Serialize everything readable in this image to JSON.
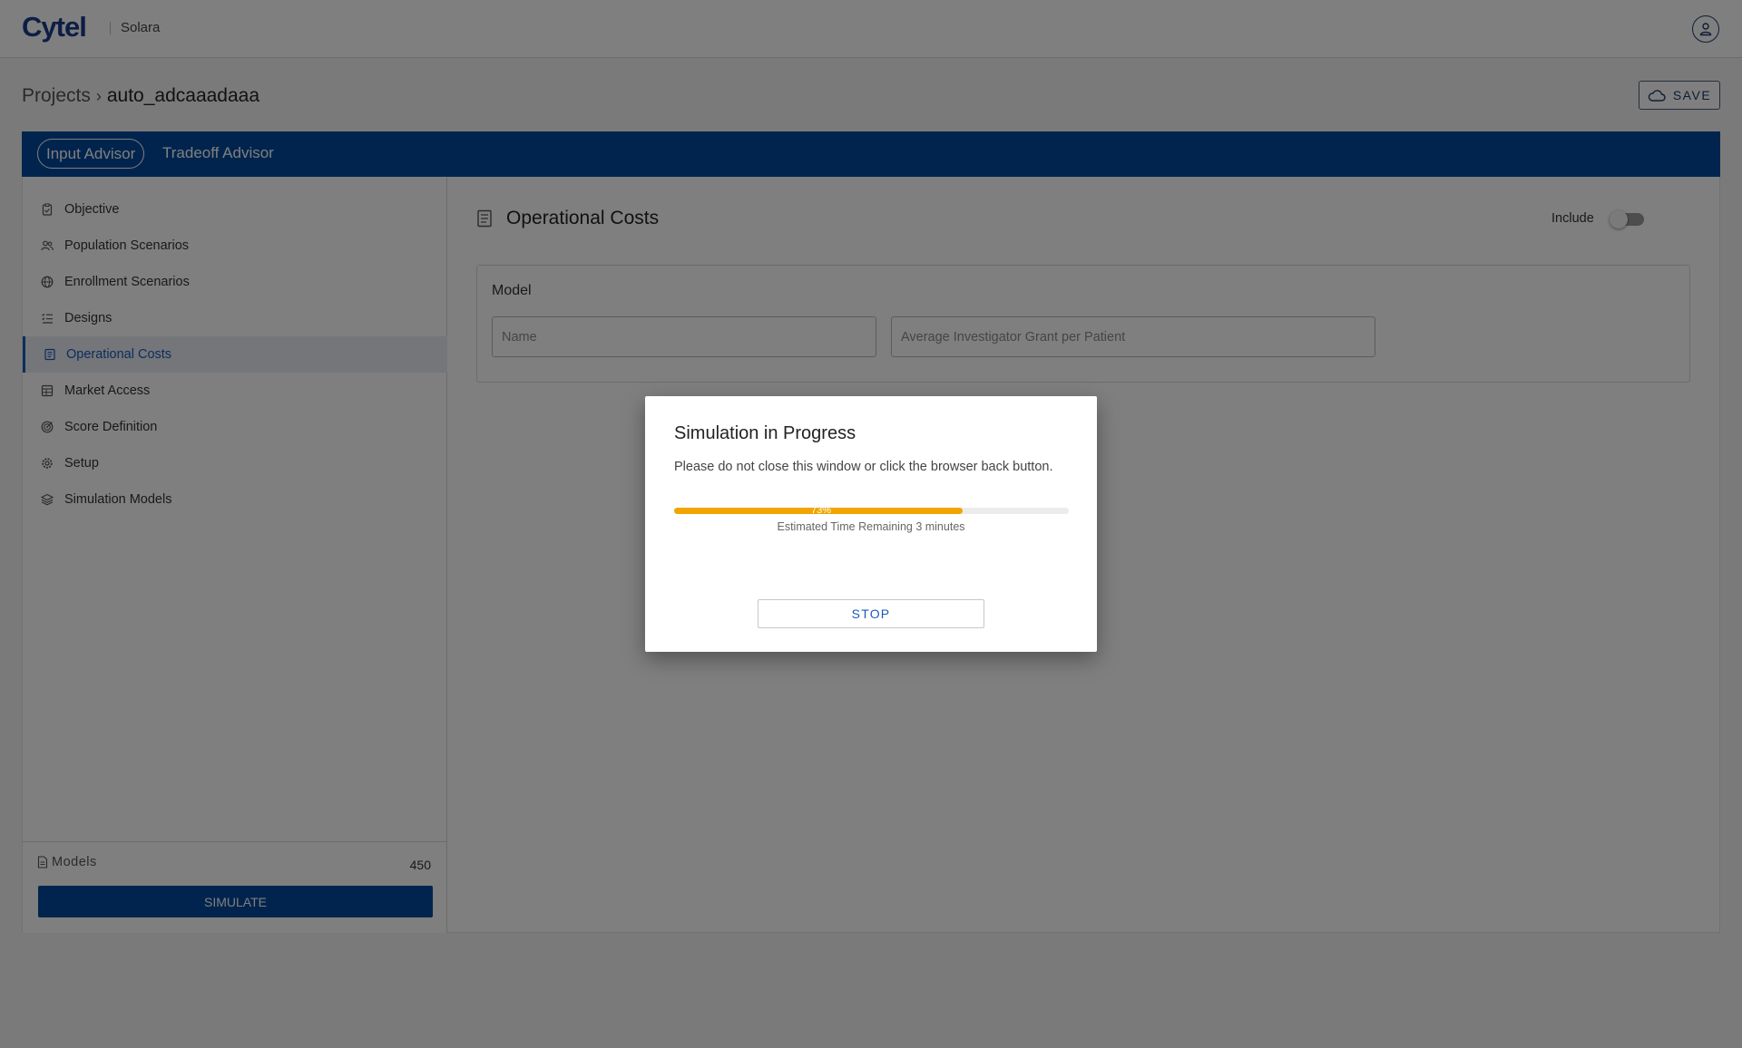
{
  "header": {
    "logo": "Cytel",
    "app_name": "Solara"
  },
  "breadcrumb": {
    "root": "Projects",
    "current": "auto_adcaaadaaa"
  },
  "toolbar": {
    "save_label": "SAVE"
  },
  "tabs": [
    {
      "label": "Input Advisor",
      "active": true
    },
    {
      "label": "Tradeoff Advisor",
      "active": false
    }
  ],
  "sidebar": {
    "items": [
      {
        "label": "Objective",
        "icon": "clipboard-icon"
      },
      {
        "label": "Population Scenarios",
        "icon": "users-icon"
      },
      {
        "label": "Enrollment Scenarios",
        "icon": "globe-icon"
      },
      {
        "label": "Designs",
        "icon": "list-icon"
      },
      {
        "label": "Operational Costs",
        "icon": "receipt-icon",
        "active": true
      },
      {
        "label": "Market Access",
        "icon": "table-icon"
      },
      {
        "label": "Score Definition",
        "icon": "target-icon"
      },
      {
        "label": "Setup",
        "icon": "gear-icon"
      },
      {
        "label": "Simulation Models",
        "icon": "layers-icon"
      }
    ],
    "models_label": "Models",
    "models_count": "450",
    "simulate_label": "SIMULATE"
  },
  "content": {
    "title": "Operational Costs",
    "include_label": "Include",
    "include_on": false,
    "model_section_title": "Model",
    "name_placeholder": "Name",
    "grant_placeholder": "Average Investigator Grant per Patient"
  },
  "dialog": {
    "title": "Simulation in Progress",
    "message": "Please do not close this window or click the browser back button.",
    "progress_percent": 73,
    "progress_label": "73%",
    "eta": "Estimated Time Remaining 3 minutes",
    "stop_label": "STOP"
  },
  "colors": {
    "brand": "#00499b",
    "progress": "#f0a500",
    "accent": "#1a5ab8"
  }
}
